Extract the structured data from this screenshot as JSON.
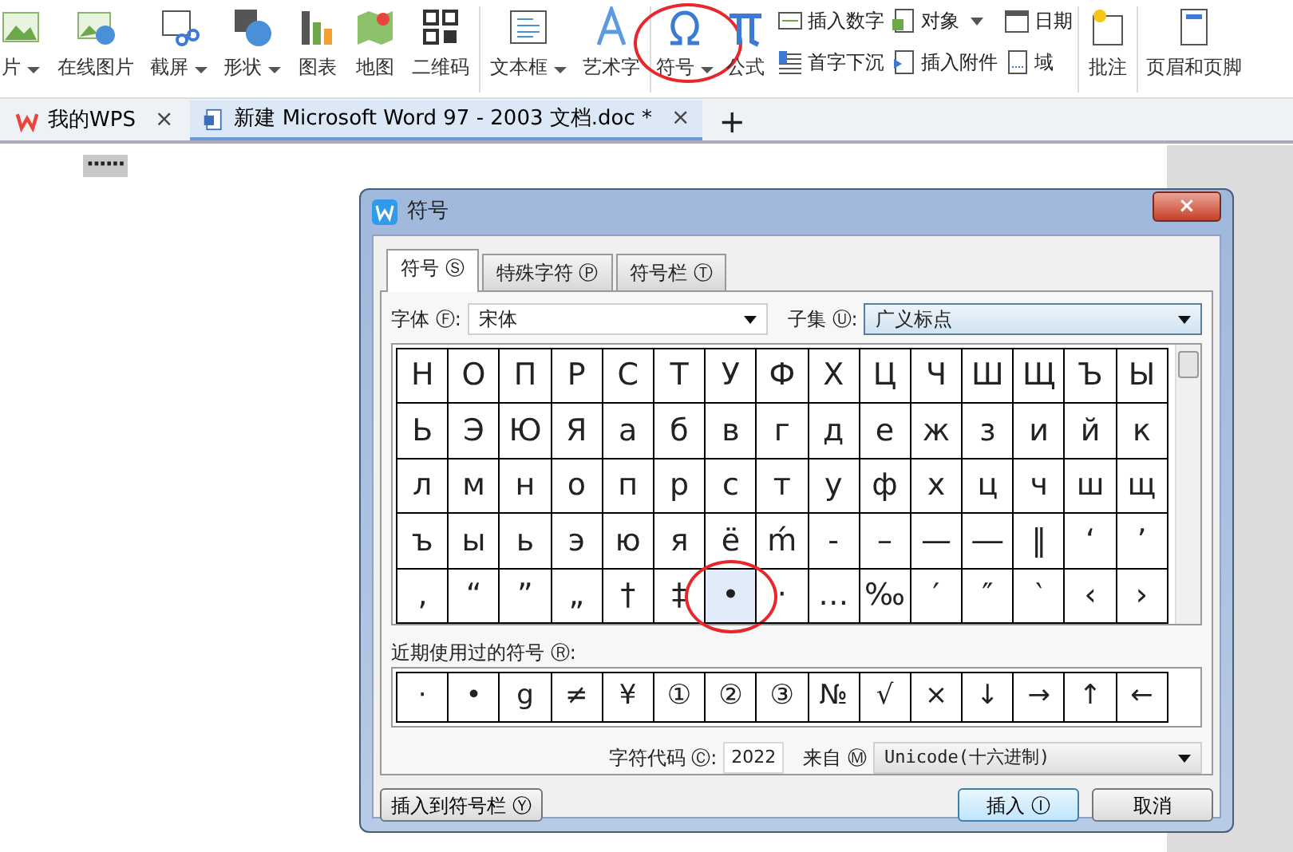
{
  "ribbon": {
    "items": [
      {
        "label": "片",
        "caret": true,
        "circled": false
      },
      {
        "label": "在线图片",
        "caret": false,
        "circled": false
      },
      {
        "label": "截屏",
        "caret": true,
        "circled": false
      },
      {
        "label": "形状",
        "caret": true,
        "circled": false
      },
      {
        "label": "图表",
        "caret": false,
        "circled": false
      },
      {
        "label": "地图",
        "caret": false,
        "circled": false
      },
      {
        "label": "二维码",
        "caret": false,
        "circled": false
      },
      {
        "label": "文本框",
        "caret": true,
        "circled": false
      },
      {
        "label": "艺术字",
        "caret": false,
        "circled": false
      },
      {
        "label": "符号",
        "caret": true,
        "circled": true
      },
      {
        "label": "公式",
        "caret": false,
        "circled": false
      }
    ],
    "small_items": [
      {
        "label": "插入数字",
        "caret": false
      },
      {
        "label": "首字下沉",
        "caret": false
      },
      {
        "label": "对象",
        "caret": true
      },
      {
        "label": "插入附件",
        "caret": false
      },
      {
        "label": "日期",
        "caret": false
      },
      {
        "label": "域",
        "caret": false
      }
    ],
    "end_items": [
      {
        "label": "批注"
      },
      {
        "label": "页眉和页脚"
      }
    ]
  },
  "tabs": [
    {
      "label": "我的WPS",
      "selected": false
    },
    {
      "label": "新建 Microsoft Word 97 - 2003 文档.doc *",
      "selected": true
    }
  ],
  "new_tab": "+",
  "document": {
    "selected_text": "······"
  },
  "dialog": {
    "title": "符号",
    "close": "×",
    "tabs": [
      {
        "label": "符号 Ⓢ",
        "selected": true
      },
      {
        "label": "特殊字符 Ⓟ",
        "selected": false
      },
      {
        "label": "符号栏 Ⓣ",
        "selected": false
      }
    ],
    "font_label": "字体 Ⓕ:",
    "font_value": "宋体",
    "subset_label": "子集 Ⓤ:",
    "subset_value": "广义标点",
    "grid": [
      [
        {
          "ch": "Н"
        },
        {
          "ch": "О"
        },
        {
          "ch": "П"
        },
        {
          "ch": "Р"
        },
        {
          "ch": "С"
        },
        {
          "ch": "Т"
        },
        {
          "ch": "У"
        },
        {
          "ch": "Ф"
        },
        {
          "ch": "Х"
        },
        {
          "ch": "Ц"
        },
        {
          "ch": "Ч"
        },
        {
          "ch": "Ш"
        },
        {
          "ch": "Щ"
        },
        {
          "ch": "Ъ"
        },
        {
          "ch": "Ы"
        }
      ],
      [
        {
          "ch": "Ь"
        },
        {
          "ch": "Э"
        },
        {
          "ch": "Ю"
        },
        {
          "ch": "Я"
        },
        {
          "ch": "а"
        },
        {
          "ch": "б"
        },
        {
          "ch": "в"
        },
        {
          "ch": "г"
        },
        {
          "ch": "д"
        },
        {
          "ch": "е"
        },
        {
          "ch": "ж"
        },
        {
          "ch": "з"
        },
        {
          "ch": "и"
        },
        {
          "ch": "й"
        },
        {
          "ch": "к"
        }
      ],
      [
        {
          "ch": "л"
        },
        {
          "ch": "м"
        },
        {
          "ch": "н"
        },
        {
          "ch": "о"
        },
        {
          "ch": "п"
        },
        {
          "ch": "р"
        },
        {
          "ch": "с"
        },
        {
          "ch": "т"
        },
        {
          "ch": "у"
        },
        {
          "ch": "ф"
        },
        {
          "ch": "х"
        },
        {
          "ch": "ц"
        },
        {
          "ch": "ч"
        },
        {
          "ch": "ш"
        },
        {
          "ch": "щ"
        }
      ],
      [
        {
          "ch": "ъ"
        },
        {
          "ch": "ы"
        },
        {
          "ch": "ь"
        },
        {
          "ch": "э"
        },
        {
          "ch": "ю"
        },
        {
          "ch": "я"
        },
        {
          "ch": "ё"
        },
        {
          "ch": "ḿ"
        },
        {
          "ch": "‐"
        },
        {
          "ch": "–"
        },
        {
          "ch": "—"
        },
        {
          "ch": "―"
        },
        {
          "ch": "‖"
        },
        {
          "ch": "‘"
        },
        {
          "ch": "’"
        }
      ],
      [
        {
          "ch": "‚"
        },
        {
          "ch": "“"
        },
        {
          "ch": "”"
        },
        {
          "ch": "„"
        },
        {
          "ch": "†"
        },
        {
          "ch": "‡"
        },
        {
          "ch": "•",
          "selected": true,
          "circled": true
        },
        {
          "ch": "‧"
        },
        {
          "ch": "…"
        },
        {
          "ch": "‰"
        },
        {
          "ch": "′"
        },
        {
          "ch": "″"
        },
        {
          "ch": "‵"
        },
        {
          "ch": "‹"
        },
        {
          "ch": "›"
        }
      ]
    ],
    "recent_label": "近期使用过的符号 Ⓡ:",
    "recent": [
      "·",
      "•",
      "g",
      "≠",
      "¥",
      "①",
      "②",
      "③",
      "№",
      "√",
      "×",
      "↓",
      "→",
      "↑",
      "←"
    ],
    "code_label": "字符代码 Ⓒ:",
    "code_value": "2022",
    "from_label": "来自 Ⓜ",
    "from_value": "Unicode(十六进制)",
    "buttons": [
      {
        "label": "插入到符号栏 Ⓨ",
        "kind": "left"
      },
      {
        "label": "插入 Ⓘ",
        "kind": "primary"
      },
      {
        "label": "取消",
        "kind": "normal"
      }
    ]
  }
}
